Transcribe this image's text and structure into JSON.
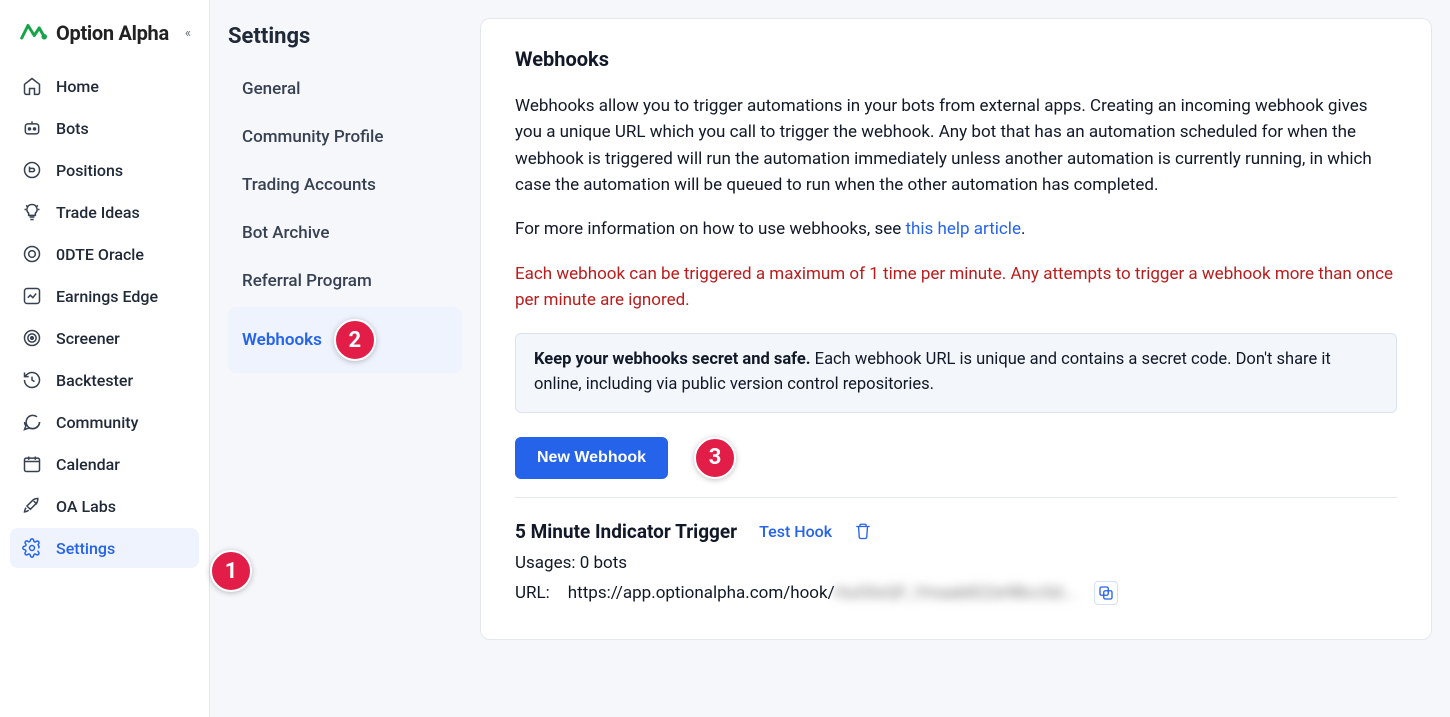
{
  "brand": {
    "name": "Option Alpha"
  },
  "sidebar": {
    "items": [
      {
        "label": "Home"
      },
      {
        "label": "Bots"
      },
      {
        "label": "Positions"
      },
      {
        "label": "Trade Ideas"
      },
      {
        "label": "0DTE Oracle"
      },
      {
        "label": "Earnings Edge"
      },
      {
        "label": "Screener"
      },
      {
        "label": "Backtester"
      },
      {
        "label": "Community"
      },
      {
        "label": "Calendar"
      },
      {
        "label": "OA Labs"
      },
      {
        "label": "Settings"
      }
    ]
  },
  "settings_nav": {
    "heading": "Settings",
    "items": [
      {
        "label": "General"
      },
      {
        "label": "Community Profile"
      },
      {
        "label": "Trading Accounts"
      },
      {
        "label": "Bot Archive"
      },
      {
        "label": "Referral Program"
      },
      {
        "label": "Webhooks"
      }
    ]
  },
  "annotations": {
    "badge1": "1",
    "badge2": "2",
    "badge3": "3"
  },
  "page": {
    "title": "Webhooks",
    "description": "Webhooks allow you to trigger automations in your bots from external apps. Creating an incoming webhook gives you a unique URL which you call to trigger the webhook. Any bot that has an automation scheduled for when the webhook is triggered will run the automation immediately unless another automation is currently running, in which case the automation will be queued to run when the other automation has completed.",
    "more_info_prefix": "For more information on how to use webhooks, see ",
    "more_info_link_text": "this help article",
    "more_info_suffix": ".",
    "rate_limit_warning": "Each webhook can be triggered a maximum of 1 time per minute. Any attempts to trigger a webhook more than once per minute are ignored.",
    "secret_notice_bold": "Keep your webhooks secret and safe.",
    "secret_notice_rest": " Each webhook URL is unique and contains a secret code. Don't share it online, including via public version control repositories.",
    "new_webhook_button": "New Webhook"
  },
  "webhooks": [
    {
      "name": "5 Minute Indicator Trigger",
      "test_label": "Test Hook",
      "usage_label": "Usages: 0 bots",
      "url_label": "URL:",
      "url_visible_prefix": "https://app.optionalpha.com/hook/",
      "url_secret_masked": "HuO0xQF_Ymaab822e9BccSd..."
    }
  ]
}
